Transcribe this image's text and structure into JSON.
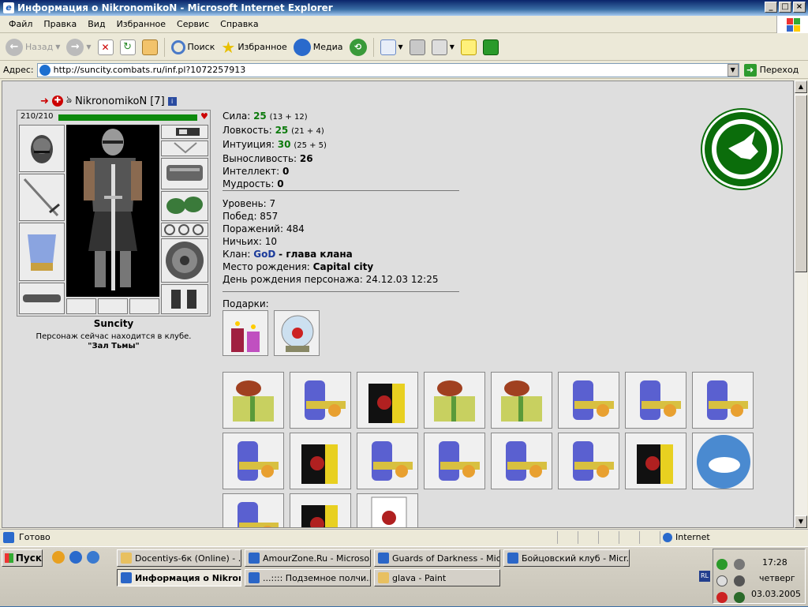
{
  "window": {
    "title": "Информация о NikronomikoN - Microsoft Internet Explorer",
    "icon": "ie-icon",
    "buttons": [
      "_",
      "□",
      "×"
    ]
  },
  "menu": [
    "Файл",
    "Правка",
    "Вид",
    "Избранное",
    "Сервис",
    "Справка"
  ],
  "toolbar": {
    "back": "Назад",
    "search": "Поиск",
    "favorites": "Избранное",
    "media": "Медиа"
  },
  "address": {
    "label": "Адрес:",
    "url": "http://suncity.combats.ru/inf.pl?1072257913",
    "go": "Переход"
  },
  "character": {
    "name": "NikronomikoN",
    "level_tag": "[7]",
    "hp": "210/210",
    "hp_fraction": 1.0,
    "city": "Suncity",
    "location_text": "Персонаж сейчас находится в клубе.",
    "room": "\"Зал Тьмы\""
  },
  "stats": [
    {
      "label": "Сила:",
      "value": "25",
      "extra": "(13 + 12)",
      "green": true
    },
    {
      "label": "Ловкость:",
      "value": "25",
      "extra": "(21 + 4)",
      "green": true
    },
    {
      "label": "Интуиция:",
      "value": "30",
      "extra": "(25 + 5)",
      "green": true
    },
    {
      "label": "Выносливость:",
      "value": "26",
      "extra": "",
      "green": false
    },
    {
      "label": "Интеллект:",
      "value": "0",
      "extra": "",
      "green": false
    },
    {
      "label": "Мудрость:",
      "value": "0",
      "extra": "",
      "green": false
    }
  ],
  "info": {
    "level": "Уровень: 7",
    "wins": "Побед: 857",
    "losses": "Поражений: 484",
    "draws": "Ничьих: 10",
    "clan_label": "Клан:",
    "clan_name": "GoD",
    "clan_role": "- глава клана",
    "birthplace_label": "Место рождения:",
    "birthplace": "Capital city",
    "birthday": "День рождения персонажа: 24.12.03 12:25"
  },
  "gifts_label": "Подарки:",
  "status": {
    "text": "Готово",
    "zone": "Internet"
  },
  "taskbar": {
    "start": "Пуск",
    "tasks": [
      "Docentiys-6к (Online) - ...",
      "AmourZone.Ru - Microso...",
      "Guards of Darkness - Mic...",
      "Бойцовский клуб - Micr...",
      "Информация о Nikron...",
      "...:::: Подземное полчи...",
      "glava - Paint"
    ],
    "lang": "RL",
    "time": "17:28",
    "day": "четверг",
    "date": "03.03.2005"
  },
  "colors": {
    "accent": "#0a246a",
    "stat_green": "#0c7a0c",
    "clan_blue": "#1a3a9a",
    "emblem_green": "#0b6d0b"
  }
}
